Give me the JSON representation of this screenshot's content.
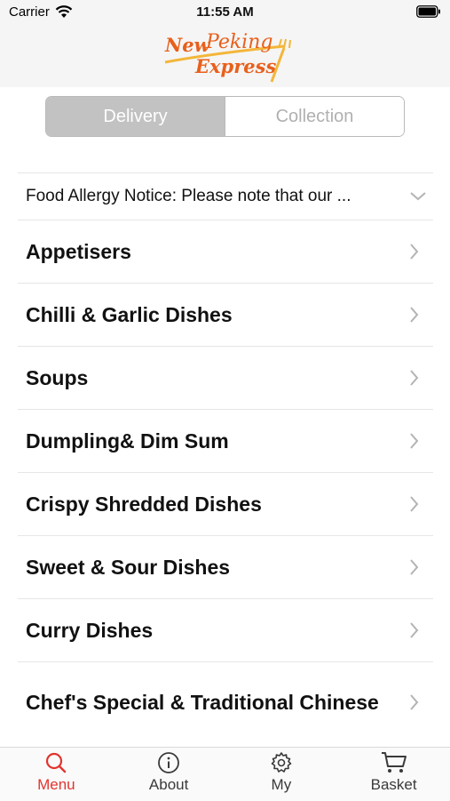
{
  "status_bar": {
    "carrier": "Carrier",
    "time": "11:55 AM"
  },
  "header": {
    "logo_line1": "New Peking",
    "logo_line2": "Express",
    "logo_color": "#e8601c"
  },
  "order_mode": {
    "options": [
      "Delivery",
      "Collection"
    ],
    "selected": "Delivery"
  },
  "notice": {
    "text": "Food Allergy Notice: Please note that our ..."
  },
  "categories": [
    {
      "label": "Appetisers"
    },
    {
      "label": "Chilli & Garlic Dishes"
    },
    {
      "label": "Soups"
    },
    {
      "label": "Dumpling& Dim Sum"
    },
    {
      "label": "Crispy Shredded Dishes"
    },
    {
      "label": "Sweet & Sour Dishes"
    },
    {
      "label": "Curry Dishes"
    },
    {
      "label": "Chef's Special & Traditional Chinese"
    }
  ],
  "tabbar": {
    "items": [
      {
        "label": "Menu",
        "icon": "search-icon"
      },
      {
        "label": "About",
        "icon": "info-icon"
      },
      {
        "label": "My",
        "icon": "gear-icon"
      },
      {
        "label": "Basket",
        "icon": "cart-icon"
      }
    ],
    "active": "Menu",
    "active_color": "#e2342f"
  }
}
